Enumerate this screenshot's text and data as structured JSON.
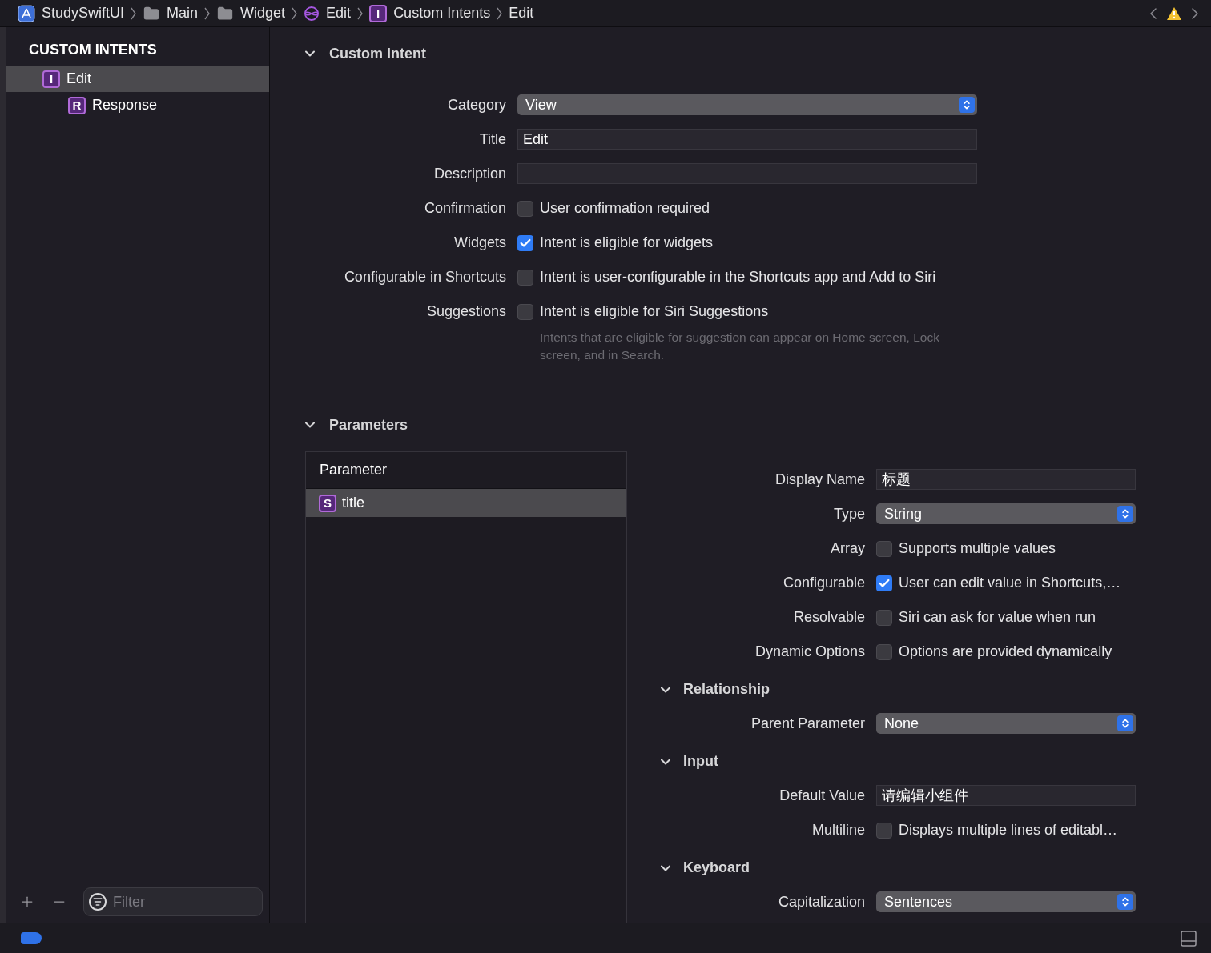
{
  "breadcrumbs": [
    {
      "kind": "app",
      "label": "StudySwiftUI"
    },
    {
      "kind": "folder",
      "label": "Main"
    },
    {
      "kind": "folder",
      "label": "Widget"
    },
    {
      "kind": "intents",
      "label": "Edit"
    },
    {
      "kind": "badge",
      "badge": "I",
      "label": "Custom Intents"
    },
    {
      "kind": "plain",
      "label": "Edit"
    }
  ],
  "sidebar": {
    "title": "CUSTOM INTENTS",
    "items": [
      {
        "badge": "I",
        "label": "Edit",
        "selected": true,
        "children": [
          {
            "badge": "R",
            "label": "Response",
            "selected": false
          }
        ]
      }
    ],
    "filter": {
      "placeholder": "Filter"
    }
  },
  "custom_intent": {
    "title": "Custom Intent",
    "expanded": true,
    "fields": [
      {
        "kind": "popup",
        "label": "Category",
        "value": "View"
      },
      {
        "kind": "text",
        "label": "Title",
        "value": "Edit"
      },
      {
        "kind": "text",
        "label": "Description"
      },
      {
        "kind": "checkbox",
        "label": "Confirmation",
        "text": "User confirmation required",
        "checked": false
      },
      {
        "kind": "checkbox",
        "label": "Widgets",
        "text": "Intent is eligible for widgets",
        "checked": true
      },
      {
        "kind": "checkbox",
        "label": "Configurable in Shortcuts",
        "text": "Intent is user-configurable in the Shortcuts app and Add to Siri",
        "checked": false
      },
      {
        "kind": "checkbox",
        "label": "Suggestions",
        "text": "Intent is eligible for Siri Suggestions",
        "checked": false,
        "hint": "Intents that are eligible for suggestion can appear on Home screen, Lock screen, and in Search."
      }
    ]
  },
  "parameters": {
    "title": "Parameters",
    "expanded": true,
    "list": {
      "header": "Parameter",
      "items": [
        {
          "badge": "S",
          "label": "title",
          "selected": true
        }
      ]
    },
    "fields": [
      {
        "kind": "text",
        "label": "Display Name",
        "value": "标题"
      },
      {
        "kind": "popup",
        "label": "Type",
        "value": "String"
      },
      {
        "kind": "checkbox",
        "label": "Array",
        "text": "Supports multiple values",
        "checked": false
      },
      {
        "kind": "checkbox",
        "label": "Configurable",
        "text": "User can edit value in Shortcuts,…",
        "checked": true
      },
      {
        "kind": "checkbox",
        "label": "Resolvable",
        "text": "Siri can ask for value when run",
        "checked": false
      },
      {
        "kind": "checkbox",
        "label": "Dynamic Options",
        "text": "Options are provided dynamically",
        "checked": false
      },
      {
        "kind": "header",
        "label": "Relationship",
        "expanded": true
      },
      {
        "kind": "popup",
        "label": "Parent Parameter",
        "value": "None"
      },
      {
        "kind": "header",
        "label": "Input",
        "expanded": true
      },
      {
        "kind": "text",
        "label": "Default Value",
        "value": "请编辑小组件"
      },
      {
        "kind": "checkbox",
        "label": "Multiline",
        "text": "Displays multiple lines of editabl…",
        "checked": false
      },
      {
        "kind": "header",
        "label": "Keyboard",
        "expanded": true
      },
      {
        "kind": "popup",
        "label": "Capitalization",
        "value": "Sentences"
      }
    ]
  }
}
